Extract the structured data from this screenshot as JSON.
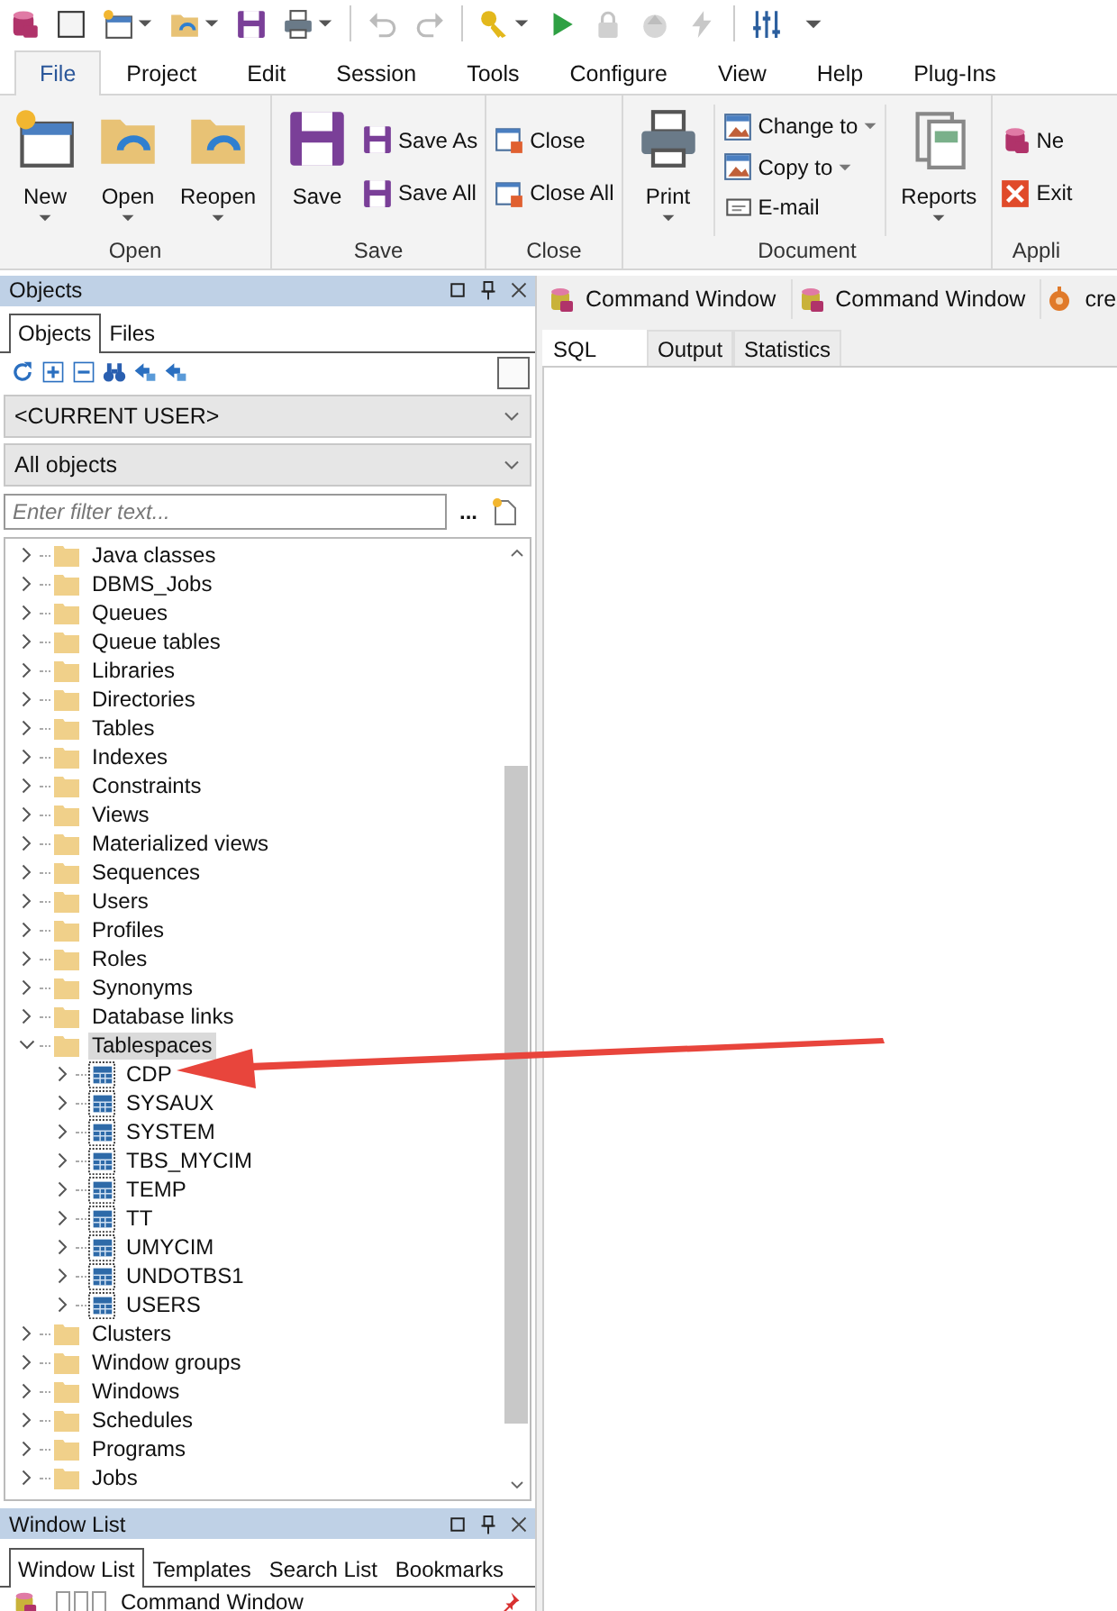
{
  "ribbon": {
    "tabs": [
      {
        "label": "File",
        "selected": true
      },
      {
        "label": "Project",
        "selected": false
      },
      {
        "label": "Edit",
        "selected": false
      },
      {
        "label": "Session",
        "selected": false
      },
      {
        "label": "Tools",
        "selected": false
      },
      {
        "label": "Configure",
        "selected": false
      },
      {
        "label": "View",
        "selected": false
      },
      {
        "label": "Help",
        "selected": false
      },
      {
        "label": "Plug-Ins",
        "selected": false
      }
    ],
    "groups": [
      {
        "label": "Open",
        "columns": [
          {
            "kind": "large",
            "separated": false,
            "items": [
              {
                "label": "New",
                "dropdown": true
              }
            ]
          },
          {
            "kind": "large",
            "separated": false,
            "items": [
              {
                "label": "Open",
                "dropdown": true
              }
            ]
          },
          {
            "kind": "large",
            "separated": false,
            "items": [
              {
                "label": "Reopen",
                "dropdown": true
              }
            ]
          }
        ]
      },
      {
        "label": "Save",
        "columns": [
          {
            "kind": "large",
            "separated": false,
            "items": [
              {
                "label": "Save",
                "dropdown": false
              }
            ]
          },
          {
            "kind": "small",
            "separated": false,
            "items": [
              {
                "label": "Save As",
                "dropdown": false
              },
              {
                "label": "Save All",
                "dropdown": false
              }
            ]
          }
        ]
      },
      {
        "label": "Close",
        "columns": [
          {
            "kind": "small",
            "separated": false,
            "items": [
              {
                "label": "Close",
                "dropdown": false
              },
              {
                "label": "Close All",
                "dropdown": false
              }
            ]
          }
        ]
      },
      {
        "label": "Document",
        "columns": [
          {
            "kind": "large",
            "separated": false,
            "items": [
              {
                "label": "Print",
                "dropdown": true
              }
            ]
          },
          {
            "kind": "small",
            "separated": true,
            "items": [
              {
                "label": "Change to",
                "dropdown": true
              },
              {
                "label": "Copy to",
                "dropdown": true
              },
              {
                "label": "E-mail",
                "dropdown": false
              }
            ]
          },
          {
            "kind": "large",
            "separated": true,
            "items": [
              {
                "label": "Reports",
                "dropdown": true
              }
            ]
          }
        ]
      },
      {
        "label": "Appli",
        "columns": [
          {
            "kind": "small",
            "separated": false,
            "items": [
              {
                "label": "Ne",
                "dropdown": false
              },
              {
                "label": "Exit",
                "dropdown": false
              }
            ]
          }
        ]
      }
    ]
  },
  "objects_panel": {
    "title": "Objects",
    "tabs": [
      {
        "label": "Objects",
        "selected": true
      },
      {
        "label": "Files",
        "selected": false
      }
    ],
    "owner_select": {
      "value": "<CURRENT USER>"
    },
    "type_select": {
      "value": "All objects"
    },
    "filter": {
      "placeholder": "Enter filter text..."
    },
    "more_button": "...",
    "tree": [
      {
        "label": "Java classes",
        "kind": "folder",
        "expanded": false,
        "selected": false
      },
      {
        "label": "DBMS_Jobs",
        "kind": "folder",
        "expanded": false,
        "selected": false
      },
      {
        "label": "Queues",
        "kind": "folder",
        "expanded": false,
        "selected": false
      },
      {
        "label": "Queue tables",
        "kind": "folder",
        "expanded": false,
        "selected": false
      },
      {
        "label": "Libraries",
        "kind": "folder",
        "expanded": false,
        "selected": false
      },
      {
        "label": "Directories",
        "kind": "folder",
        "expanded": false,
        "selected": false
      },
      {
        "label": "Tables",
        "kind": "folder",
        "expanded": false,
        "selected": false
      },
      {
        "label": "Indexes",
        "kind": "folder",
        "expanded": false,
        "selected": false
      },
      {
        "label": "Constraints",
        "kind": "folder",
        "expanded": false,
        "selected": false
      },
      {
        "label": "Views",
        "kind": "folder",
        "expanded": false,
        "selected": false
      },
      {
        "label": "Materialized views",
        "kind": "folder",
        "expanded": false,
        "selected": false
      },
      {
        "label": "Sequences",
        "kind": "folder",
        "expanded": false,
        "selected": false
      },
      {
        "label": "Users",
        "kind": "folder",
        "expanded": false,
        "selected": false
      },
      {
        "label": "Profiles",
        "kind": "folder",
        "expanded": false,
        "selected": false
      },
      {
        "label": "Roles",
        "kind": "folder",
        "expanded": false,
        "selected": false
      },
      {
        "label": "Synonyms",
        "kind": "folder",
        "expanded": false,
        "selected": false
      },
      {
        "label": "Database links",
        "kind": "folder",
        "expanded": false,
        "selected": false
      },
      {
        "label": "Tablespaces",
        "kind": "folder",
        "expanded": true,
        "selected": true,
        "children": [
          {
            "label": "CDP",
            "kind": "tablespace",
            "expanded": false,
            "selected": false
          },
          {
            "label": "SYSAUX",
            "kind": "tablespace",
            "expanded": false,
            "selected": false
          },
          {
            "label": "SYSTEM",
            "kind": "tablespace",
            "expanded": false,
            "selected": false
          },
          {
            "label": "TBS_MYCIM",
            "kind": "tablespace",
            "expanded": false,
            "selected": false
          },
          {
            "label": "TEMP",
            "kind": "tablespace",
            "expanded": false,
            "selected": false
          },
          {
            "label": "TT",
            "kind": "tablespace",
            "expanded": false,
            "selected": false
          },
          {
            "label": "UMYCIM",
            "kind": "tablespace",
            "expanded": false,
            "selected": false
          },
          {
            "label": "UNDOTBS1",
            "kind": "tablespace",
            "expanded": false,
            "selected": false
          },
          {
            "label": "USERS",
            "kind": "tablespace",
            "expanded": false,
            "selected": false
          }
        ]
      },
      {
        "label": "Clusters",
        "kind": "folder",
        "expanded": false,
        "selected": false
      },
      {
        "label": "Window groups",
        "kind": "folder",
        "expanded": false,
        "selected": false
      },
      {
        "label": "Windows",
        "kind": "folder",
        "expanded": false,
        "selected": false
      },
      {
        "label": "Schedules",
        "kind": "folder",
        "expanded": false,
        "selected": false
      },
      {
        "label": "Programs",
        "kind": "folder",
        "expanded": false,
        "selected": false
      },
      {
        "label": "Jobs",
        "kind": "folder",
        "expanded": false,
        "selected": false
      }
    ]
  },
  "window_list_panel": {
    "title": "Window List",
    "tabs": [
      {
        "label": "Window List",
        "selected": true
      },
      {
        "label": "Templates",
        "selected": false
      },
      {
        "label": "Search List",
        "selected": false
      },
      {
        "label": "Bookmarks",
        "selected": false
      }
    ],
    "windows": [
      {
        "label": "Command Window",
        "kind": "command"
      }
    ]
  },
  "document_tabs": [
    {
      "label": "Command Window",
      "kind": "command"
    },
    {
      "label": "Command Window",
      "kind": "command"
    },
    {
      "label": "cre",
      "kind": "program"
    }
  ],
  "editor_tabs": [
    {
      "label": "SQL",
      "selected": true
    },
    {
      "label": "Output",
      "selected": false
    },
    {
      "label": "Statistics",
      "selected": false
    }
  ]
}
